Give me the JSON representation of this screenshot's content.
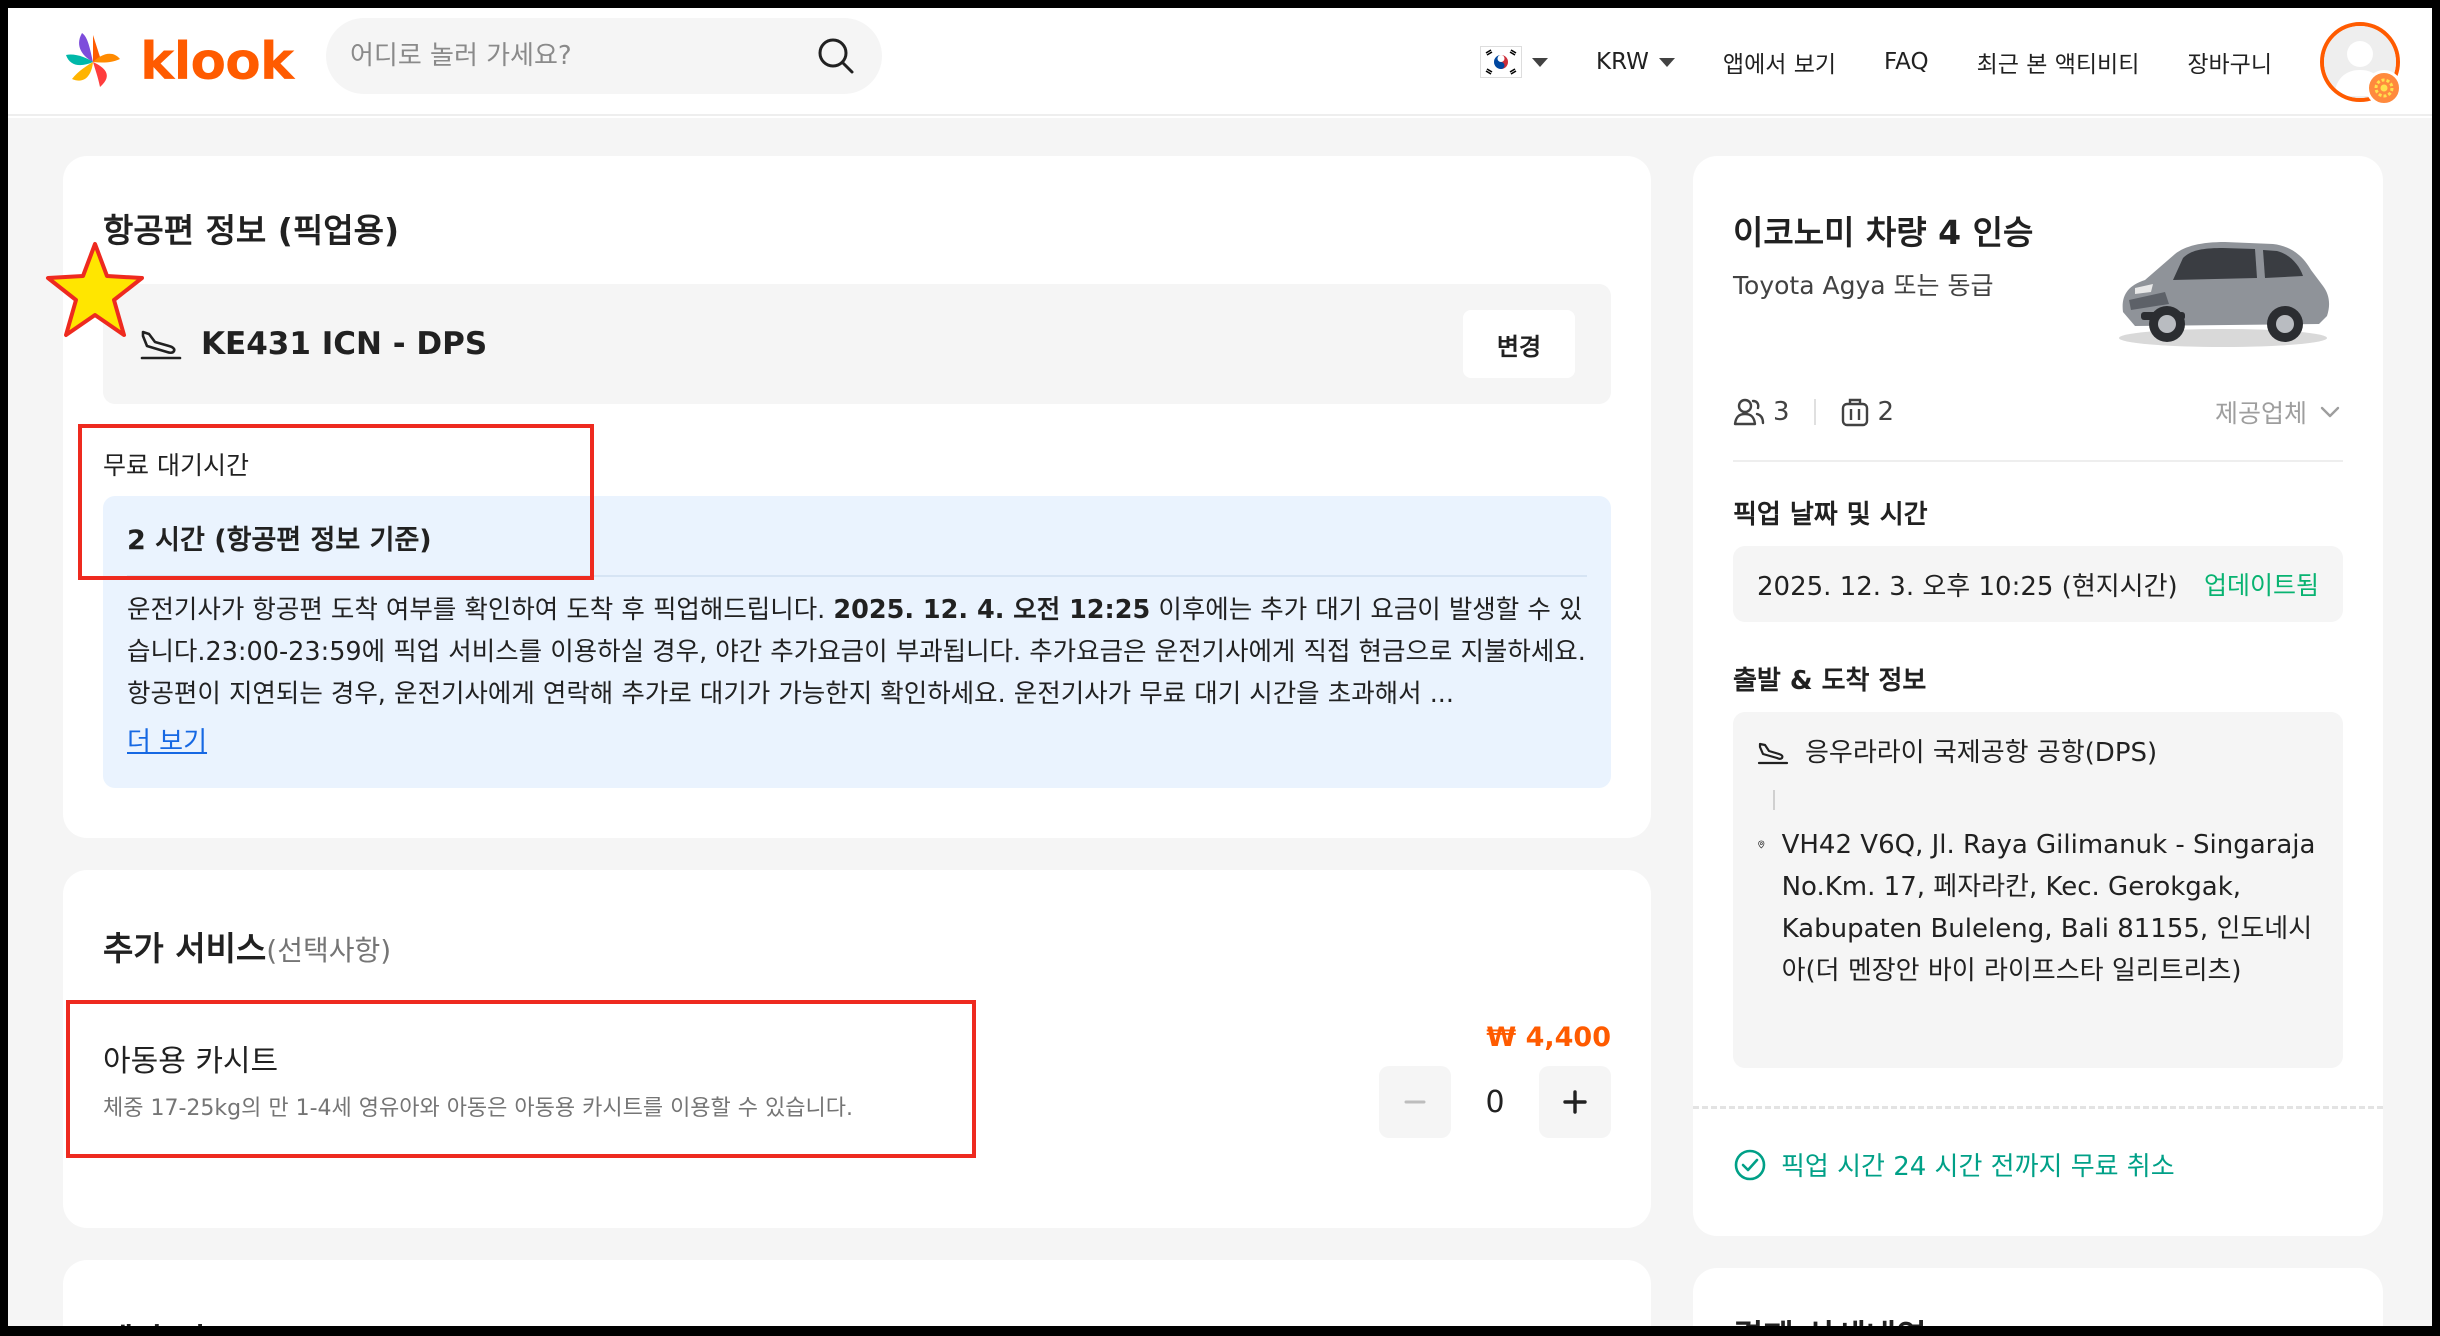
{
  "header": {
    "logo_text": "klook",
    "search_placeholder": "어디로 놀러 가세요?",
    "currency": "KRW",
    "nav": [
      "앱에서 보기",
      "FAQ",
      "최근 본 액티비티",
      "장바구니"
    ]
  },
  "flight": {
    "title": "항공편 정보 (픽업용)",
    "code": "KE431 ICN - DPS",
    "change_label": "변경",
    "wait_label": "무료 대기시간",
    "wait_head": "2 시간 (항공편 정보 기준)",
    "desc_1": "운전기사가 항공편 도착 여부를 확인하여 도착 후 픽업해드립니다. ",
    "desc_bold": "2025. 12. 4. 오전 12:25",
    "desc_2": " 이후에는 추가 대기 요금이 발생할 수 있습니다.23:00-23:59에 픽업 서비스를 이용하실 경우, 야간 추가요금이 부과됩니다. 추가요금은 운전기사에게 직접 현금으로 지불하세요.항공편이 지연되는 경우, 운전기사에게 연락해 추가로 대기가 가능한지 확인하세요. 운전기사가 무료 대기 시간을 초과해서 ...",
    "more_label": "더 보기"
  },
  "extra": {
    "title": "추가 서비스",
    "optional": "(선택사항)",
    "seat_name": "아동용 카시트",
    "seat_desc": "체중 17-25kg의 만 1-4세 영유아와 아동은 아동용 카시트를 이용할 수 있습니다.",
    "price": "₩ 4,400",
    "qty": "0"
  },
  "reservation": {
    "title": "예약 정보"
  },
  "summary": {
    "car_title": "이코노미 차량 4 인승",
    "car_model": "Toyota Agya 또는 동급",
    "passengers": "3",
    "luggage": "2",
    "provider_label": "제공업체",
    "pickup_label": "픽업 날짜 및 시간",
    "pickup_time": "2025. 12. 3. 오후 10:25 (현지시간)",
    "updated_label": "업데이트됨",
    "route_label": "출발 & 도착 정보",
    "origin": "응우라라이 국제공항 공항(DPS)",
    "destination": "VH42 V6Q, Jl. Raya Gilimanuk - Singaraja No.Km. 17, 페자라칸, Kec. Gerokgak, Kabupaten Buleleng, Bali 81155, 인도네시아(더 멘장안 바이 라이프스타 일리트리츠)",
    "cancel_text": "픽업 시간 24 시간 전까지 무료 취소",
    "payment_title": "결제 상세내역"
  },
  "colors": {
    "brand": "#ff5b00",
    "link": "#1668e3",
    "success": "#08b371",
    "annotation": "#ee2a1f"
  }
}
